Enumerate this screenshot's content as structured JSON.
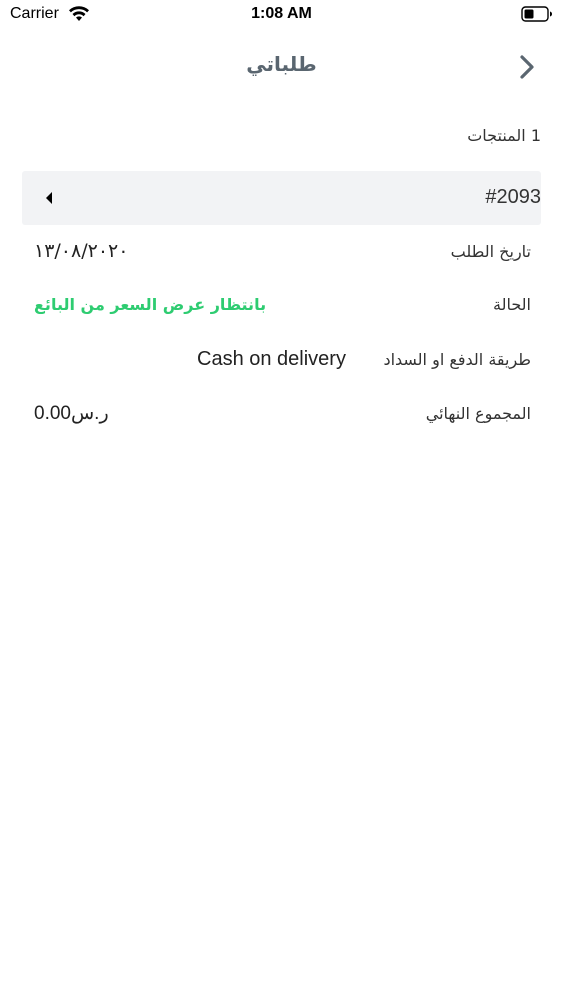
{
  "status_bar": {
    "carrier": "Carrier",
    "time": "1:08 AM"
  },
  "nav": {
    "title": "طلباتي",
    "back_icon": "chevron-right-icon"
  },
  "orders": {
    "products_count": "1 المنتجات",
    "order": {
      "number": "#2093",
      "rows": {
        "date": {
          "label": "تاريخ الطلب",
          "value": "١٣/٠٨/٢٠٢٠"
        },
        "status": {
          "label": "الحالة",
          "value": "بانتظار عرض السعر من البائع"
        },
        "payment": {
          "label": "طريقة الدفع او السداد",
          "value": "Cash on delivery"
        },
        "total": {
          "label": "المجموع النهائي",
          "value": "0.00ر.س"
        }
      }
    }
  },
  "colors": {
    "status_green": "#2ecc71",
    "title_gray": "#5a6670",
    "header_bg": "#f2f3f5"
  }
}
